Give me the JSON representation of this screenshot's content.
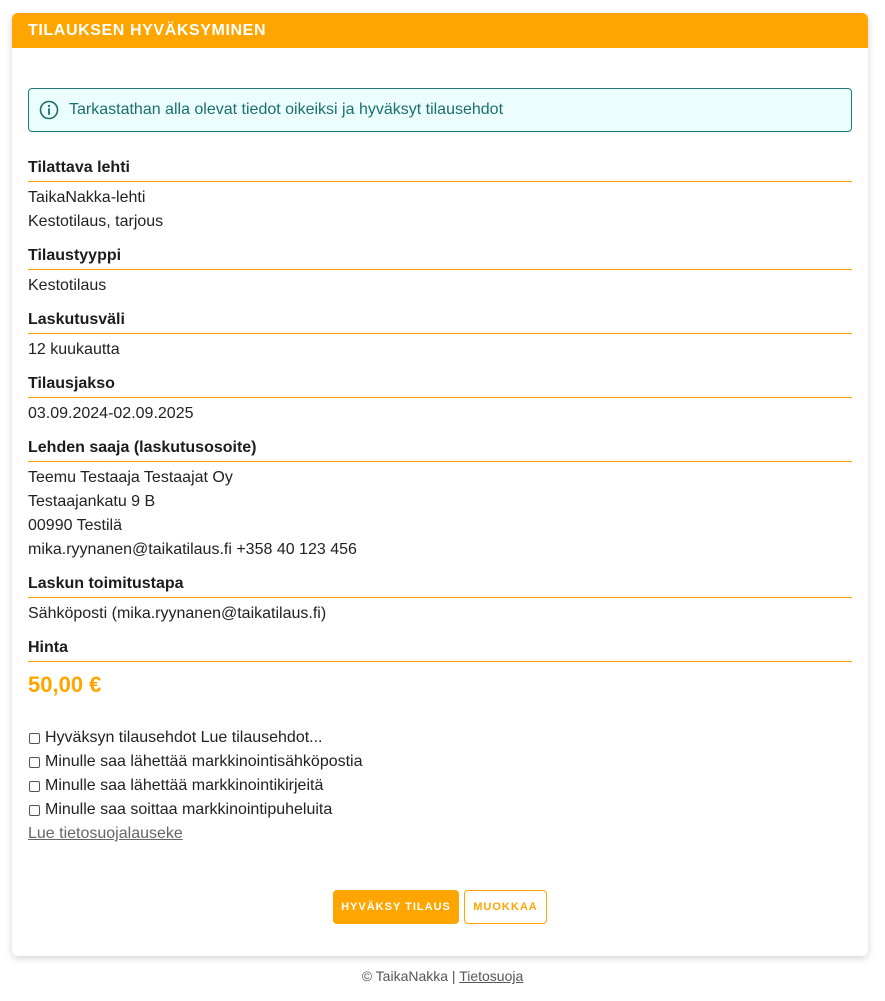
{
  "header": {
    "title": "TILAUKSEN HYVÄKSYMINEN"
  },
  "alert": {
    "icon": "info-icon",
    "text": "Tarkastathan alla olevat tiedot oikeiksi ja hyväksyt tilausehdot"
  },
  "sections": {
    "magazine": {
      "title": "Tilattava lehti",
      "lines": [
        "TaikaNakka-lehti",
        "Kestotilaus, tarjous"
      ]
    },
    "order_type": {
      "title": "Tilaustyyppi",
      "lines": [
        "Kestotilaus"
      ]
    },
    "billing_interval": {
      "title": "Laskutusväli",
      "lines": [
        "12 kuukautta"
      ]
    },
    "period": {
      "title": "Tilausjakso",
      "lines": [
        "03.09.2024-02.09.2025"
      ]
    },
    "recipient": {
      "title": "Lehden saaja (laskutusosoite)",
      "lines": [
        "Teemu Testaaja Testaajat Oy",
        "Testaajankatu 9 B",
        "00990 Testilä",
        "mika.ryynanen@taikatilaus.fi +358 40 123 456"
      ]
    },
    "invoice_delivery": {
      "title": "Laskun toimitustapa",
      "lines": [
        "Sähköposti (mika.ryynanen@taikatilaus.fi)"
      ]
    },
    "price": {
      "title": "Hinta",
      "value": "50,00 €"
    }
  },
  "checkboxes": [
    {
      "label": "Hyväksyn tilausehdot Lue tilausehdot...",
      "checked": false
    },
    {
      "label": "Minulle saa lähettää markkinointisähköpostia",
      "checked": false
    },
    {
      "label": "Minulle saa lähettää markkinointikirjeitä",
      "checked": false
    },
    {
      "label": "Minulle saa soittaa markkinointipuheluita",
      "checked": false
    }
  ],
  "privacy_link": "Lue tietosuojalauseke",
  "buttons": {
    "approve": "HYVÄKSY TILAUS",
    "edit": "MUOKKAA"
  },
  "footer": {
    "copyright": "© TaikaNakka |",
    "privacy": "Tietosuoja"
  },
  "colors": {
    "accent": "#ffa500",
    "alert_text": "#1a6f6f",
    "alert_bg": "#ecfdfd"
  }
}
